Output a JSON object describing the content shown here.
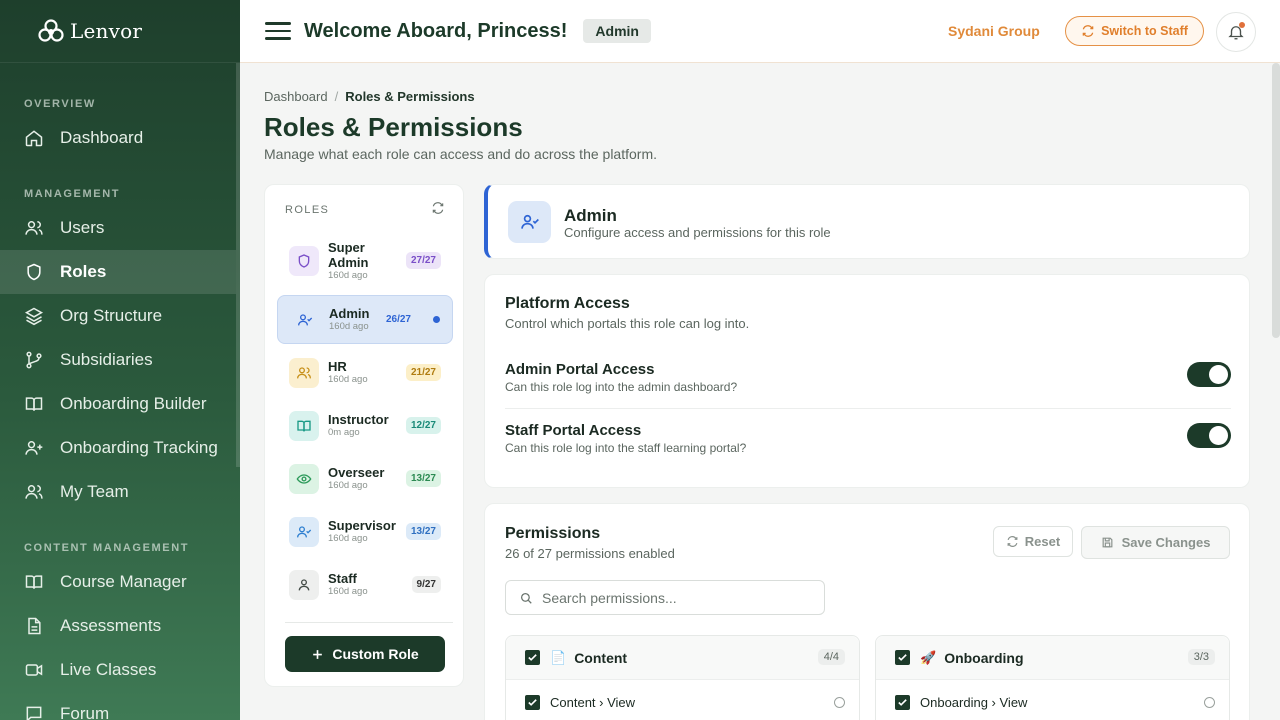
{
  "brand": {
    "name": "Lenvor"
  },
  "sidebar": {
    "sections": [
      {
        "title": "OVERVIEW",
        "items": [
          {
            "label": "Dashboard",
            "icon": "home-icon"
          }
        ]
      },
      {
        "title": "MANAGEMENT",
        "items": [
          {
            "label": "Users",
            "icon": "users-icon"
          },
          {
            "label": "Roles",
            "icon": "shield-icon",
            "active": true
          },
          {
            "label": "Org Structure",
            "icon": "layers-icon"
          },
          {
            "label": "Subsidiaries",
            "icon": "branch-icon"
          },
          {
            "label": "Onboarding Builder",
            "icon": "book-icon"
          },
          {
            "label": "Onboarding Tracking",
            "icon": "user-plus-icon"
          },
          {
            "label": "My Team",
            "icon": "users-icon"
          }
        ]
      },
      {
        "title": "CONTENT MANAGEMENT",
        "items": [
          {
            "label": "Course Manager",
            "icon": "book-icon"
          },
          {
            "label": "Assessments",
            "icon": "document-icon"
          },
          {
            "label": "Live Classes",
            "icon": "video-icon"
          },
          {
            "label": "Forum",
            "icon": "chat-icon"
          }
        ]
      }
    ]
  },
  "header": {
    "welcome": "Welcome Aboard, Princess!",
    "role_badge": "Admin",
    "org_name": "Sydani Group",
    "switch_label": "Switch to Staff"
  },
  "breadcrumb": {
    "root": "Dashboard",
    "separator": "/",
    "current": "Roles & Permissions"
  },
  "page": {
    "title": "Roles & Permissions",
    "subtitle": "Manage what each role can access and do across the platform."
  },
  "roles": {
    "heading": "ROLES",
    "items": [
      {
        "name": "Super Admin",
        "time": "160d ago",
        "count": "27/27",
        "icon": "shield-icon",
        "color": "#7a4fc8",
        "bg": "#efe8fa",
        "badge_bg": "#ece4f8"
      },
      {
        "name": "Admin",
        "time": "160d ago",
        "count": "26/27",
        "icon": "user-check-icon",
        "color": "#2e64d4",
        "bg": "#dde8f8",
        "badge_bg": "#dde8f8",
        "active": true
      },
      {
        "name": "HR",
        "time": "160d ago",
        "count": "21/27",
        "icon": "users-icon",
        "color": "#c7901a",
        "bg": "#fbefcf",
        "badge_bg": "#fcefc8"
      },
      {
        "name": "Instructor",
        "time": "0m ago",
        "count": "12/27",
        "icon": "book-icon",
        "color": "#1a9a86",
        "bg": "#d9f2ee",
        "badge_bg": "#d8f2ec"
      },
      {
        "name": "Overseer",
        "time": "160d ago",
        "count": "13/27",
        "icon": "eye-icon",
        "color": "#2c9a5a",
        "bg": "#dcf3e4",
        "badge_bg": "#dcf3e4"
      },
      {
        "name": "Supervisor",
        "time": "160d ago",
        "count": "13/27",
        "icon": "user-check-icon",
        "color": "#2e7fd0",
        "bg": "#dceaf8",
        "badge_bg": "#dceaf8"
      },
      {
        "name": "Staff",
        "time": "160d ago",
        "count": "9/27",
        "icon": "user-icon",
        "color": "#454d48",
        "bg": "#eeefee",
        "badge_bg": "#eeefee"
      }
    ],
    "custom_button": "Custom Role"
  },
  "role_detail": {
    "name": "Admin",
    "description": "Configure access and permissions for this role"
  },
  "platform_access": {
    "title": "Platform Access",
    "subtitle": "Control which portals this role can log into.",
    "toggles": [
      {
        "label": "Admin Portal Access",
        "description": "Can this role log into the admin dashboard?",
        "enabled": true
      },
      {
        "label": "Staff Portal Access",
        "description": "Can this role log into the staff learning portal?",
        "enabled": true
      }
    ]
  },
  "permissions": {
    "title": "Permissions",
    "summary": "26 of 27 permissions enabled",
    "reset_label": "Reset",
    "save_label": "Save Changes",
    "search_placeholder": "Search permissions...",
    "groups": [
      {
        "name": "Content",
        "emoji": "📄",
        "count": "4/4",
        "items": [
          "Content › View"
        ]
      },
      {
        "name": "Onboarding",
        "emoji": "🚀",
        "count": "3/3",
        "items": [
          "Onboarding › View"
        ]
      }
    ]
  },
  "colors": {
    "accent": "#1c3a29",
    "brand_orange": "#e07f2c",
    "selected_blue": "#2e64d4"
  }
}
